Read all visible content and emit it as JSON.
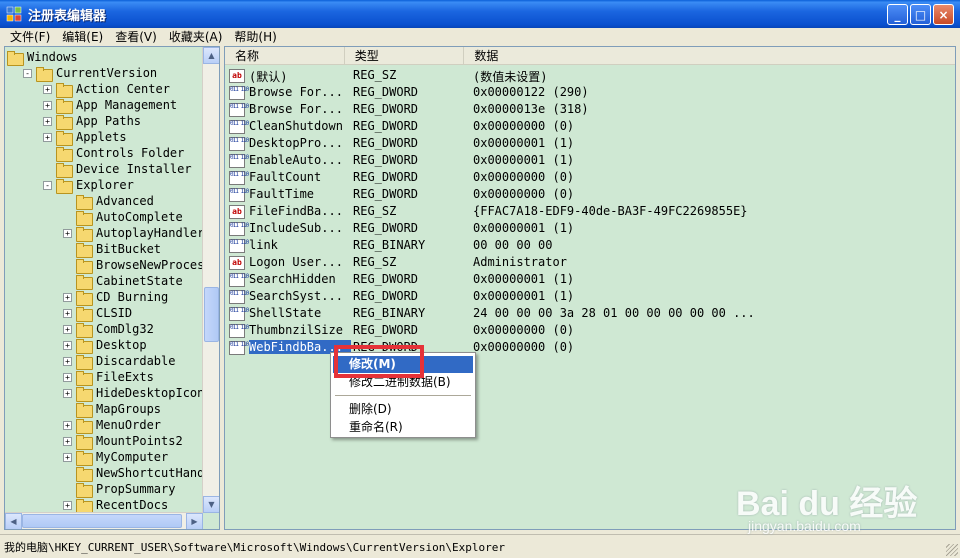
{
  "window": {
    "title": "注册表编辑器",
    "controls": [
      "_",
      "□",
      "×"
    ]
  },
  "menu": [
    "文件(F)",
    "编辑(E)",
    "查看(V)",
    "收藏夹(A)",
    "帮助(H)"
  ],
  "tree": [
    {
      "label": "Windows",
      "depth": 0,
      "expander": "",
      "open": true
    },
    {
      "label": "CurrentVersion",
      "depth": 1,
      "expander": "-",
      "open": true
    },
    {
      "label": "Action Center",
      "depth": 2,
      "expander": "+"
    },
    {
      "label": "App Management",
      "depth": 2,
      "expander": "+"
    },
    {
      "label": "App Paths",
      "depth": 2,
      "expander": "+"
    },
    {
      "label": "Applets",
      "depth": 2,
      "expander": "+"
    },
    {
      "label": "Controls Folder",
      "depth": 2,
      "expander": ""
    },
    {
      "label": "Device Installer",
      "depth": 2,
      "expander": ""
    },
    {
      "label": "Explorer",
      "depth": 2,
      "expander": "-",
      "open": true
    },
    {
      "label": "Advanced",
      "depth": 3,
      "expander": ""
    },
    {
      "label": "AutoComplete",
      "depth": 3,
      "expander": ""
    },
    {
      "label": "AutoplayHandlers",
      "depth": 3,
      "expander": "+"
    },
    {
      "label": "BitBucket",
      "depth": 3,
      "expander": ""
    },
    {
      "label": "BrowseNewProcess",
      "depth": 3,
      "expander": ""
    },
    {
      "label": "CabinetState",
      "depth": 3,
      "expander": ""
    },
    {
      "label": "CD Burning",
      "depth": 3,
      "expander": "+"
    },
    {
      "label": "CLSID",
      "depth": 3,
      "expander": "+"
    },
    {
      "label": "ComDlg32",
      "depth": 3,
      "expander": "+"
    },
    {
      "label": "Desktop",
      "depth": 3,
      "expander": "+"
    },
    {
      "label": "Discardable",
      "depth": 3,
      "expander": "+"
    },
    {
      "label": "FileExts",
      "depth": 3,
      "expander": "+"
    },
    {
      "label": "HideDesktopIcons",
      "depth": 3,
      "expander": "+"
    },
    {
      "label": "MapGroups",
      "depth": 3,
      "expander": ""
    },
    {
      "label": "MenuOrder",
      "depth": 3,
      "expander": "+"
    },
    {
      "label": "MountPoints2",
      "depth": 3,
      "expander": "+"
    },
    {
      "label": "MyComputer",
      "depth": 3,
      "expander": "+"
    },
    {
      "label": "NewShortcutHandlers",
      "depth": 3,
      "expander": ""
    },
    {
      "label": "PropSummary",
      "depth": 3,
      "expander": ""
    },
    {
      "label": "RecentDocs",
      "depth": 3,
      "expander": "+"
    }
  ],
  "columns": {
    "name": "名称",
    "type": "类型",
    "data": "数据"
  },
  "values": [
    {
      "icon": "ab",
      "name": "(默认)",
      "type": "REG_SZ",
      "data": "(数值未设置)"
    },
    {
      "icon": "bin",
      "name": "Browse For...",
      "type": "REG_DWORD",
      "data": "0x00000122 (290)"
    },
    {
      "icon": "bin",
      "name": "Browse For...",
      "type": "REG_DWORD",
      "data": "0x0000013e (318)"
    },
    {
      "icon": "bin",
      "name": "CleanShutdown",
      "type": "REG_DWORD",
      "data": "0x00000000 (0)"
    },
    {
      "icon": "bin",
      "name": "DesktopPro...",
      "type": "REG_DWORD",
      "data": "0x00000001 (1)"
    },
    {
      "icon": "bin",
      "name": "EnableAuto...",
      "type": "REG_DWORD",
      "data": "0x00000001 (1)"
    },
    {
      "icon": "bin",
      "name": "FaultCount",
      "type": "REG_DWORD",
      "data": "0x00000000 (0)"
    },
    {
      "icon": "bin",
      "name": "FaultTime",
      "type": "REG_DWORD",
      "data": "0x00000000 (0)"
    },
    {
      "icon": "ab",
      "name": "FileFindBa...",
      "type": "REG_SZ",
      "data": "{FFAC7A18-EDF9-40de-BA3F-49FC2269855E}"
    },
    {
      "icon": "bin",
      "name": "IncludeSub...",
      "type": "REG_DWORD",
      "data": "0x00000001 (1)"
    },
    {
      "icon": "bin",
      "name": "link",
      "type": "REG_BINARY",
      "data": "00 00 00 00"
    },
    {
      "icon": "ab",
      "name": "Logon User...",
      "type": "REG_SZ",
      "data": "Administrator"
    },
    {
      "icon": "bin",
      "name": "SearchHidden",
      "type": "REG_DWORD",
      "data": "0x00000001 (1)"
    },
    {
      "icon": "bin",
      "name": "SearchSyst...",
      "type": "REG_DWORD",
      "data": "0x00000001 (1)"
    },
    {
      "icon": "bin",
      "name": "ShellState",
      "type": "REG_BINARY",
      "data": "24 00 00 00 3a 28 01 00 00 00 00 00 ..."
    },
    {
      "icon": "bin",
      "name": "ThumbnzilSize",
      "type": "REG_DWORD",
      "data": "0x00000000 (0)"
    },
    {
      "icon": "bin",
      "name": "WebFindbBa...",
      "type": "REG_DWORD",
      "data": "0x00000000 (0)",
      "selected": true
    }
  ],
  "context_menu": {
    "modify": "修改(M)",
    "modify_binary": "修改二进制数据(B)",
    "delete": "删除(D)",
    "rename": "重命名(R)"
  },
  "status": {
    "path": "我的电脑\\HKEY_CURRENT_USER\\Software\\Microsoft\\Windows\\CurrentVersion\\Explorer"
  },
  "watermark": {
    "main": "Bai du 经验",
    "sub": "jingyan.baidu.com"
  },
  "colors": {
    "selection": "#316ac5",
    "pane_bg": "#cfe8d3",
    "highlight_box": "#e53238"
  }
}
